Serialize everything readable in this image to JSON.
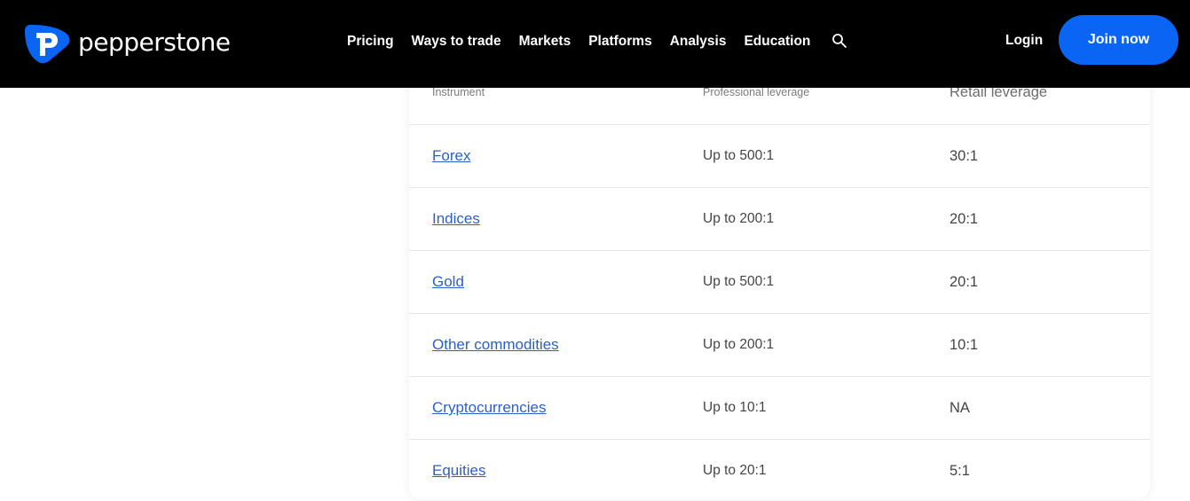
{
  "brand": {
    "name": "pepperstone",
    "accent_color": "#0a65f5"
  },
  "nav": {
    "items": [
      {
        "label": "Pricing"
      },
      {
        "label": "Ways to trade"
      },
      {
        "label": "Markets"
      },
      {
        "label": "Platforms"
      },
      {
        "label": "Analysis"
      },
      {
        "label": "Education"
      }
    ],
    "search_icon": "search-icon",
    "login_label": "Login",
    "join_label": "Join now"
  },
  "table": {
    "headers": {
      "instrument": "Instrument",
      "professional": "Professional leverage",
      "retail": "Retail leverage"
    },
    "rows": [
      {
        "instrument": "Forex",
        "professional": "Up to 500:1",
        "retail": "30:1"
      },
      {
        "instrument": "Indices",
        "professional": "Up to 200:1",
        "retail": "20:1"
      },
      {
        "instrument": "Gold",
        "professional": "Up to 500:1",
        "retail": "20:1"
      },
      {
        "instrument": "Other commodities",
        "professional": "Up to 200:1",
        "retail": "10:1"
      },
      {
        "instrument": "Cryptocurrencies",
        "professional": "Up to 10:1",
        "retail": "NA"
      },
      {
        "instrument": "Equities",
        "professional": "Up to 20:1",
        "retail": "5:1"
      }
    ]
  }
}
